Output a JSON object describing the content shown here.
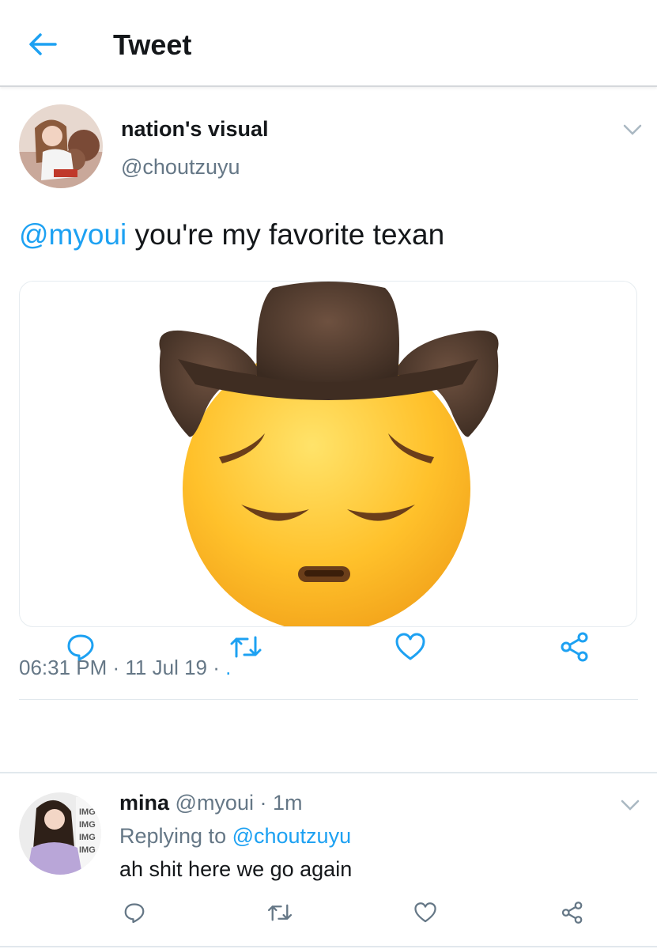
{
  "header": {
    "title": "Tweet"
  },
  "colors": {
    "accent": "#1da1f2",
    "muted": "#657786",
    "text": "#14171a",
    "divider": "#e1e8ed"
  },
  "tweet": {
    "display_name": "nation's visual",
    "handle": "@choutzuyu",
    "mention": "@myoui",
    "text": " you're my favorite texan",
    "media": {
      "description_icon": "cowboy-pensive-emoji"
    },
    "timestamp": "06:31 PM · 11 Jul 19 · ",
    "timestamp_suffix": ".",
    "actions": [
      "reply-icon",
      "retweet-icon",
      "like-icon",
      "share-icon"
    ]
  },
  "reply": {
    "display_name": "mina",
    "meta": " @myoui · 1m",
    "replying_prefix": "Replying to ",
    "replying_to": "@choutzuyu",
    "text": "ah shit here we go again",
    "actions": [
      "reply-icon",
      "retweet-icon",
      "like-icon",
      "share-icon"
    ]
  }
}
